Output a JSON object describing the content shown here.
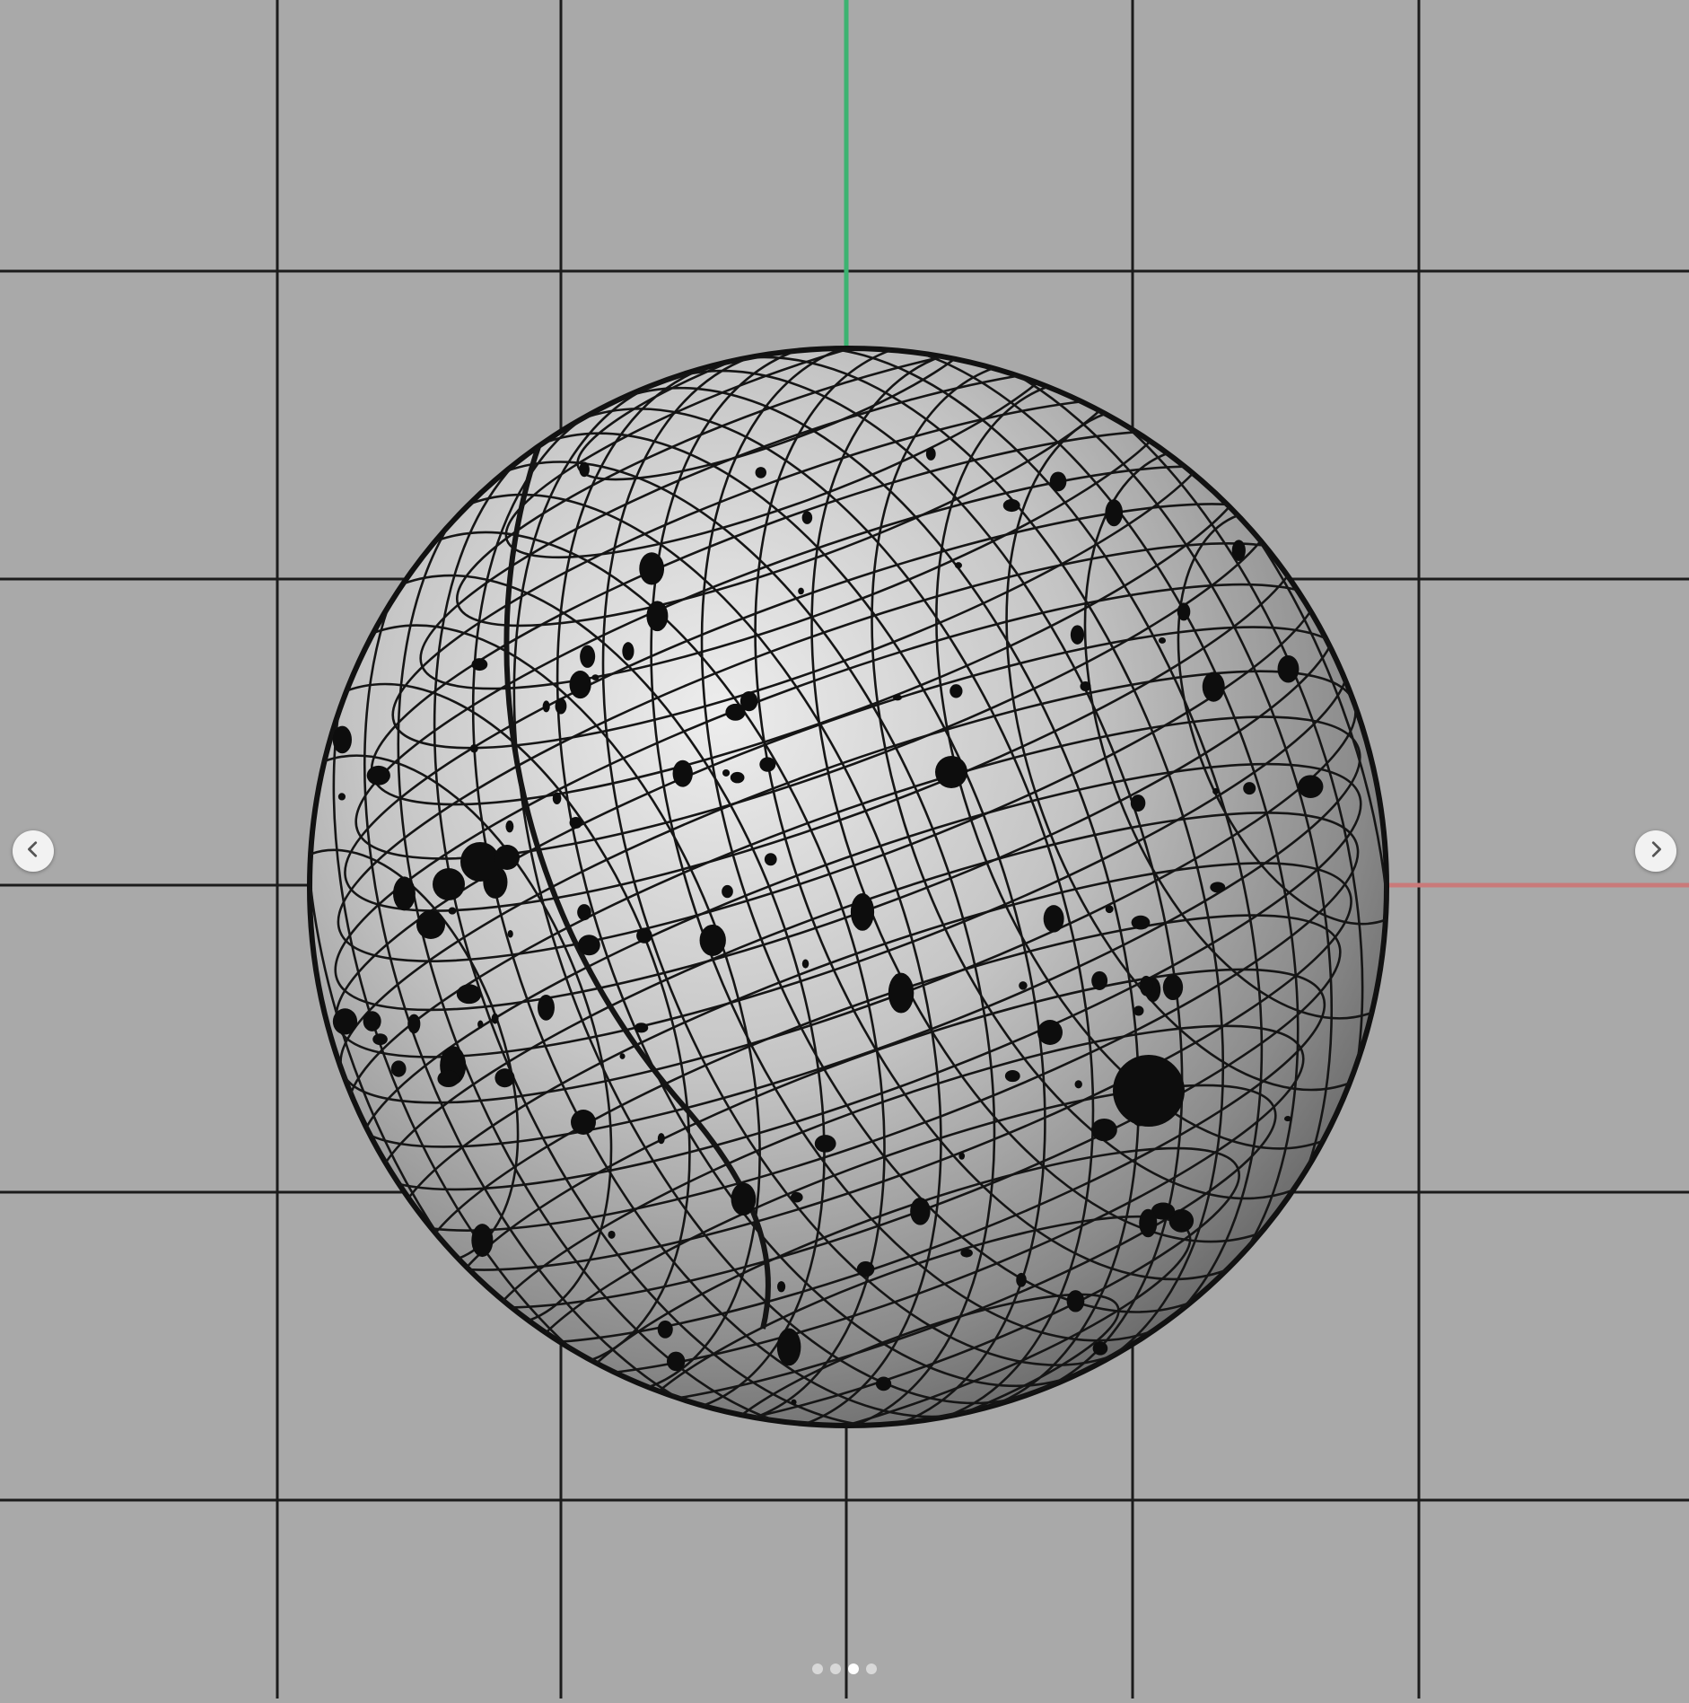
{
  "viewport": {
    "background": "#a9a9a9",
    "grid_line_color": "#1c1c1c",
    "axis_y_color": "#3cb371",
    "axis_x_color": "#c97a7a",
    "object": "sphere-wireframe-mesh"
  },
  "carousel": {
    "prev_icon": "chevron-left-icon",
    "next_icon": "chevron-right-icon",
    "slide_count": 4,
    "active_index": 2
  }
}
